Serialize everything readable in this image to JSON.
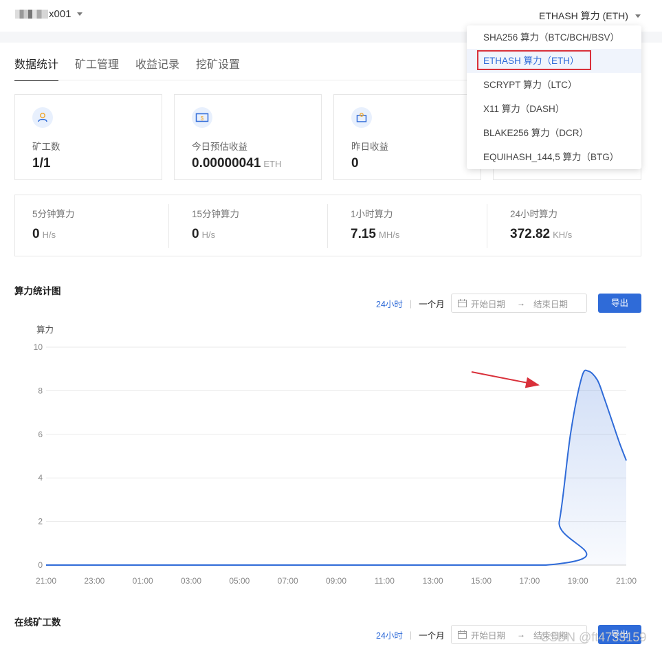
{
  "header": {
    "account_name": "x001",
    "algo_selected": "ETHASH 算力 (ETH)"
  },
  "dropdown": {
    "items": [
      {
        "label": "SHA256 算力（BTC/BCH/BSV）"
      },
      {
        "label": "ETHASH 算力（ETH）",
        "active": true
      },
      {
        "label": "SCRYPT 算力（LTC）"
      },
      {
        "label": "X11 算力（DASH）"
      },
      {
        "label": "BLAKE256 算力（DCR）"
      },
      {
        "label": "EQUIHASH_144,5 算力（BTG）"
      }
    ]
  },
  "tabs": [
    "数据统计",
    "矿工管理",
    "收益记录",
    "挖矿设置"
  ],
  "cards": [
    {
      "label": "矿工数",
      "value": "1/1",
      "unit": "",
      "icon": "user-icon"
    },
    {
      "label": "今日预估收益",
      "value": "0.00000041",
      "unit": "ETH",
      "icon": "money-icon"
    },
    {
      "label": "昨日收益",
      "value": "0",
      "unit": "",
      "icon": "wallet-icon"
    }
  ],
  "hashrates": [
    {
      "label": "5分钟算力",
      "value": "0",
      "unit": "H/s"
    },
    {
      "label": "15分钟算力",
      "value": "0",
      "unit": "H/s"
    },
    {
      "label": "1小时算力",
      "value": "7.15",
      "unit": "MH/s"
    },
    {
      "label": "24小时算力",
      "value": "372.82",
      "unit": "KH/s"
    }
  ],
  "chart_section": {
    "title": "算力统计图",
    "range_24h": "24小时",
    "range_month": "一个月",
    "start_placeholder": "开始日期",
    "end_placeholder": "结束日期",
    "export_label": "导出"
  },
  "online_section": {
    "title": "在线矿工数",
    "range_24h": "24小时",
    "range_month": "一个月",
    "start_placeholder": "开始日期",
    "end_placeholder": "结束日期",
    "export_label": "导出"
  },
  "colors": {
    "accent": "#2f6bd8",
    "annotation_red": "#d9303a"
  },
  "watermark": "CSDN @ft4733159",
  "chart_data": {
    "type": "area",
    "ylabel": "算力",
    "xlabel": "",
    "ylim": [
      0,
      10
    ],
    "yticks": [
      0,
      2,
      4,
      6,
      8,
      10
    ],
    "xtick_labels": [
      "21:00",
      "23:00",
      "01:00",
      "03:00",
      "05:00",
      "07:00",
      "09:00",
      "11:00",
      "13:00",
      "15:00",
      "17:00",
      "19:00",
      "21:00"
    ],
    "x": [
      0,
      11.2,
      11.5,
      11.75,
      12.0,
      12.15,
      12.35,
      12.5,
      12.7,
      12.85,
      13.0
    ],
    "series": [
      {
        "values": [
          0,
          0,
          2,
          6,
          8.6,
          8.9,
          8.5,
          7.7,
          6.5,
          5.6,
          4.8
        ]
      }
    ],
    "grid": true
  }
}
